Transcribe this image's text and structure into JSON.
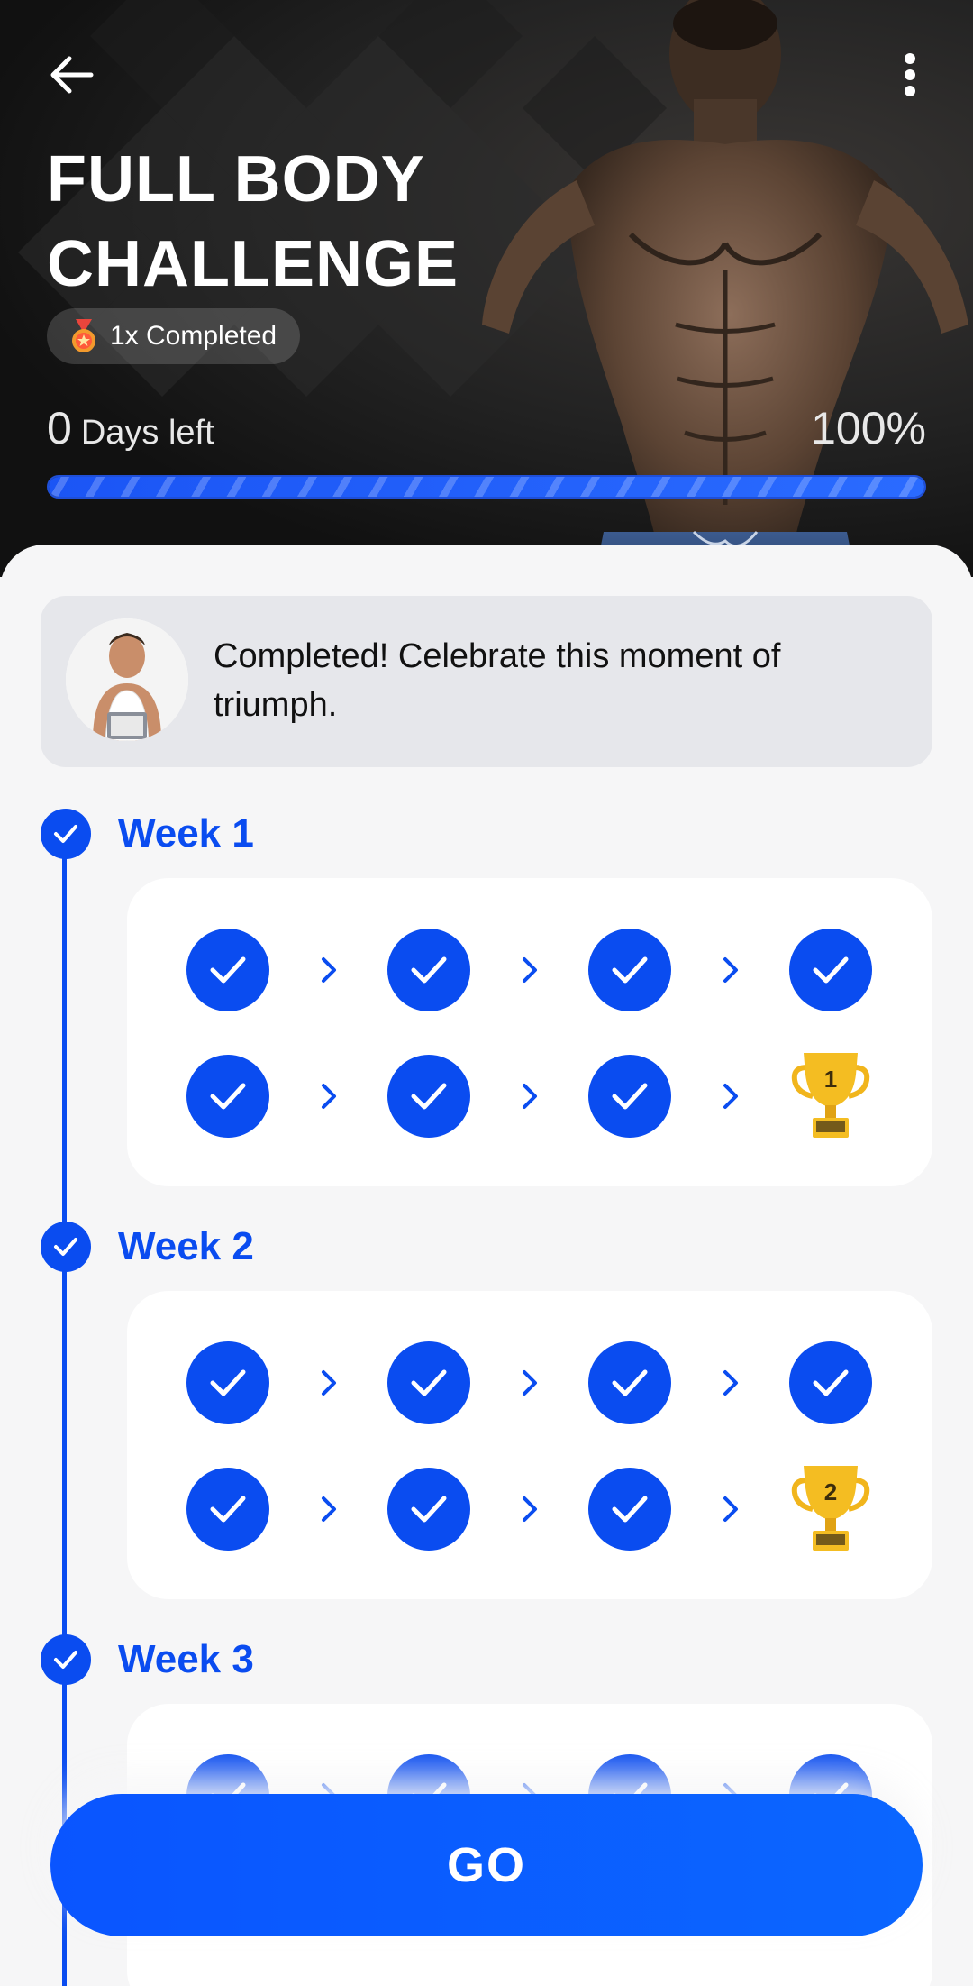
{
  "header": {
    "title_line1": "FULL BODY",
    "title_line2": "CHALLENGE",
    "completed_badge": "1x Completed",
    "days_left_value": "0",
    "days_left_label": "Days left",
    "progress_percent_text": "100%",
    "progress_value": 1.0
  },
  "coach": {
    "message": "Completed! Celebrate this moment of triumph."
  },
  "weeks": [
    {
      "title": "Week 1",
      "trophy_number": "1"
    },
    {
      "title": "Week 2",
      "trophy_number": "2"
    },
    {
      "title": "Week 3",
      "trophy_number": ""
    }
  ],
  "cta": {
    "label": "GO"
  },
  "colors": {
    "accent": "#0a4cf0",
    "button": "#0b5cff",
    "sheet_bg": "#f6f6f7",
    "card_bg": "#ffffff",
    "coach_card_bg": "#e6e7eb",
    "trophy_gold": "#f1b51c"
  },
  "icons": {
    "back": "arrow-left-icon",
    "more": "more-vertical-icon",
    "medal": "medal-icon",
    "check": "check-icon",
    "chevron": "chevron-right-icon",
    "trophy": "trophy-icon"
  }
}
